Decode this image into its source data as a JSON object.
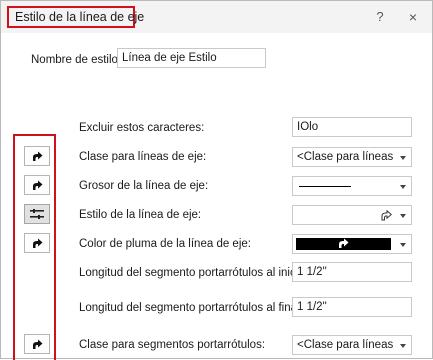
{
  "dialog": {
    "title": "Estilo de la línea de eje",
    "help_label": "?",
    "close_label": "×"
  },
  "style_name": {
    "label": "Nombre de estilo:",
    "value": "Línea de eje Estilo"
  },
  "fields": {
    "exclude": {
      "label": "Excluir estos caracteres:",
      "value": "IOlo"
    },
    "line_class": {
      "label": "Clase para líneas de eje:",
      "value": "<Clase para líneas de eje>"
    },
    "line_weight": {
      "label": "Grosor de la línea de eje:"
    },
    "line_style": {
      "label": "Estilo de la línea de eje:"
    },
    "pen_color": {
      "label": "Color de pluma de la línea de eje:",
      "color": "#000000"
    },
    "leader_start": {
      "label": "Longitud del segmento portarrótulos al inicio:",
      "value": "1 1/2\""
    },
    "leader_end": {
      "label": "Longitud del segmento portarrótulos al final:",
      "value": "1 1/2\""
    },
    "leader_class": {
      "label": "Clase para segmentos portarrótulos:",
      "value": "<Clase para líneas de eje>"
    }
  },
  "colors": {
    "highlight": "#d0101b",
    "titlebar": "#f3f3f3"
  },
  "icons": {
    "by_class": "curved-arrow-icon",
    "by_class_active": "sliders-icon"
  }
}
